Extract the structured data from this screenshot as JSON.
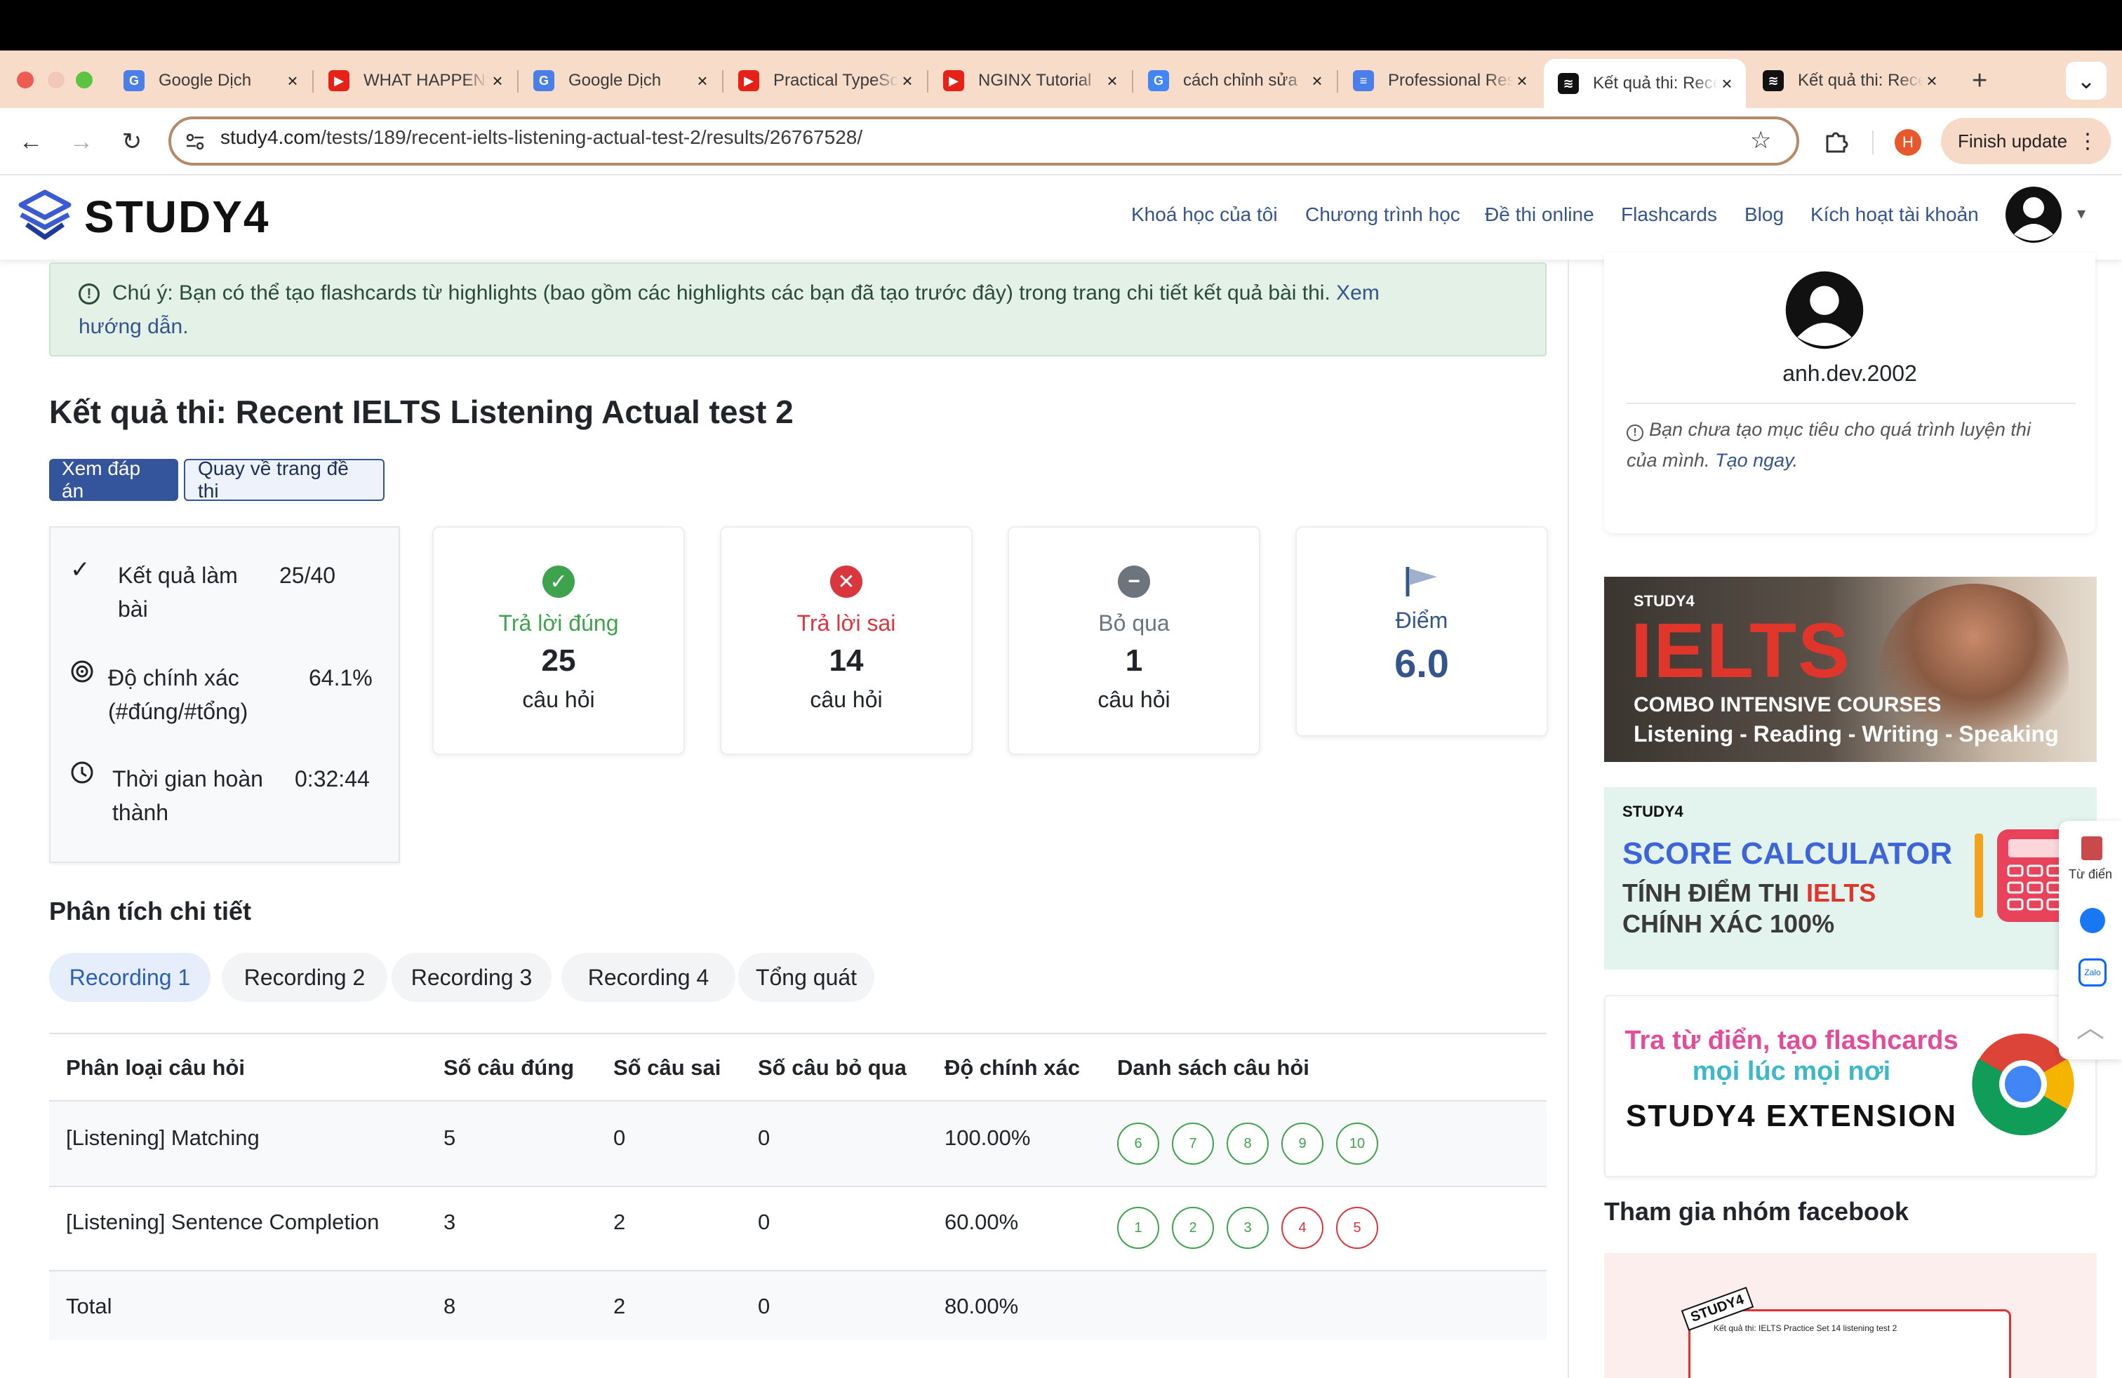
{
  "browser": {
    "tabs": [
      {
        "title": "Google Dịch",
        "icon": "google-translate-icon",
        "color": "#4a7ee8"
      },
      {
        "title": "WHAT HAPPENS",
        "icon": "youtube-icon",
        "color": "#e62117"
      },
      {
        "title": "Google Dịch",
        "icon": "google-translate-icon",
        "color": "#4a7ee8"
      },
      {
        "title": "Practical TypeScript",
        "icon": "youtube-icon",
        "color": "#e62117"
      },
      {
        "title": "NGINX Tutorial",
        "icon": "youtube-icon",
        "color": "#e62117"
      },
      {
        "title": "cách chỉnh sửa",
        "icon": "google-icon",
        "color": "#4285f4"
      },
      {
        "title": "Professional Resume",
        "icon": "docs-icon",
        "color": "#4a7ee8"
      },
      {
        "title": "Kết quả thi: Recent",
        "icon": "study4-icon",
        "color": "#111111"
      },
      {
        "title": "Kết quả thi: Recent",
        "icon": "study4-icon",
        "color": "#111111"
      }
    ],
    "new_tab": "+",
    "tab_menu": "⌄",
    "url_host": "study4.com",
    "url_path": "/tests/189/recent-ielts-listening-actual-test-2/results/26767528/",
    "profile_initial": "H",
    "finish_update": "Finish update"
  },
  "site": {
    "logo": "STUDY4",
    "nav": [
      "Khoá học của tôi",
      "Chương trình học",
      "Đề thi online",
      "Flashcards",
      "Blog",
      "Kích hoạt tài khoản"
    ]
  },
  "notice": {
    "text": "Chú ý: Bạn có thể tạo flashcards từ highlights (bao gồm các highlights các bạn đã tạo trước đây) trong trang chi tiết kết quả bài thi.",
    "link_1": "Xem",
    "link_2": "hướng dẫn."
  },
  "result": {
    "title": "Kết quả thi: Recent IELTS Listening Actual test 2",
    "btn_answers": "Xem đáp án",
    "btn_back": "Quay về trang đề thi",
    "summary": {
      "score_label_1": "Kết quả làm",
      "score_label_2": "bài",
      "score_value": "25/40",
      "accuracy_label_1": "Độ chính xác",
      "accuracy_label_2": "(#đúng/#tổng)",
      "accuracy_value": "64.1%",
      "time_label_1": "Thời gian hoàn",
      "time_label_2": "thành",
      "time_value": "0:32:44"
    },
    "cards": [
      {
        "label": "Trả lời đúng",
        "value": "25",
        "unit": "câu hỏi",
        "color": "#3fa34d"
      },
      {
        "label": "Trả lời sai",
        "value": "14",
        "unit": "câu hỏi",
        "color": "#d9363e"
      },
      {
        "label": "Bỏ qua",
        "value": "1",
        "unit": "câu hỏi",
        "color": "#6c757d"
      },
      {
        "label": "Điểm",
        "value": "6.0",
        "color": "#34558b"
      }
    ]
  },
  "analysis": {
    "title": "Phân tích chi tiết",
    "tabs": [
      "Recording 1",
      "Recording 2",
      "Recording 3",
      "Recording 4",
      "Tổng quát"
    ],
    "columns": [
      "Phân loại câu hỏi",
      "Số câu đúng",
      "Số câu sai",
      "Số câu bỏ qua",
      "Độ chính xác",
      "Danh sách câu hỏi"
    ],
    "rows": [
      {
        "type": "[Listening] Matching",
        "correct": "5",
        "wrong": "0",
        "skipped": "0",
        "accuracy": "100.00%",
        "questions": [
          {
            "n": "6",
            "ok": true
          },
          {
            "n": "7",
            "ok": true
          },
          {
            "n": "8",
            "ok": true
          },
          {
            "n": "9",
            "ok": true
          },
          {
            "n": "10",
            "ok": true
          }
        ]
      },
      {
        "type": "[Listening] Sentence Completion",
        "correct": "3",
        "wrong": "2",
        "skipped": "0",
        "accuracy": "60.00%",
        "questions": [
          {
            "n": "1",
            "ok": true
          },
          {
            "n": "2",
            "ok": true
          },
          {
            "n": "3",
            "ok": true
          },
          {
            "n": "4",
            "ok": false
          },
          {
            "n": "5",
            "ok": false
          }
        ]
      },
      {
        "type": "Total",
        "correct": "8",
        "wrong": "2",
        "skipped": "0",
        "accuracy": "80.00%",
        "questions": []
      }
    ]
  },
  "sidebar": {
    "username": "anh.dev.2002",
    "goal_text_1": "Bạn chưa tạo mục tiêu cho quá trình luyện thi",
    "goal_text_2": "của mình.",
    "goal_link": "Tạo ngay.",
    "ad1": {
      "brand": "STUDY4",
      "big": "IELTS",
      "line1": "COMBO INTENSIVE COURSES",
      "line2": "Listening - Reading - Writing - Speaking"
    },
    "ad2": {
      "brand": "STUDY4",
      "title": "SCORE CALCULATOR",
      "line1a": "TÍNH ĐIỂM THI ",
      "line1b": "IELTS",
      "line2": "CHÍNH XÁC 100%"
    },
    "ad3": {
      "line1": "Tra từ điển, tạo flashcards",
      "line2": "mọi lúc mọi nơi",
      "line3": "STUDY4 EXTENSION"
    },
    "fb_title": "Tham gia nhóm facebook",
    "fb_img_brand": "STUDY4",
    "fb_img_caption": "Kết quả thi: IELTS Practice Set 14 listening test 2",
    "float_dict": "Từ điển",
    "float_zalo": "Zalo"
  }
}
